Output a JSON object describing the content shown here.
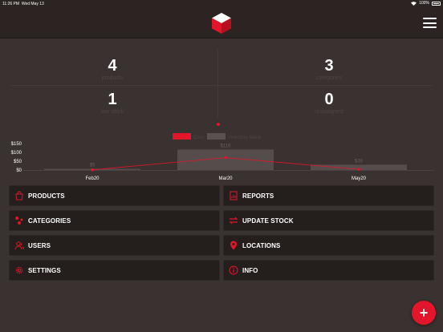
{
  "status_bar": {
    "time": "11:26 PM",
    "date": "Wed May 13",
    "battery": "100%"
  },
  "stats": [
    {
      "value": "4",
      "label": "products"
    },
    {
      "value": "3",
      "label": "categories"
    },
    {
      "value": "1",
      "label": "low stock"
    },
    {
      "value": "0",
      "label": "unassigned"
    }
  ],
  "chart_data": {
    "type": "bar",
    "categories": [
      "Feb20",
      "Mar20",
      "May20"
    ],
    "legend": [
      "Cost",
      "Inventory Value"
    ],
    "series": [
      {
        "name": "Inventory Value",
        "type": "bar",
        "values": [
          5,
          116,
          30
        ],
        "data_labels": [
          "$5",
          "$116",
          "$30"
        ],
        "color": "#5a5250"
      },
      {
        "name": "Cost",
        "type": "line",
        "values": [
          1,
          70,
          4
        ],
        "color": "#e3152a"
      }
    ],
    "y_ticks": [
      "$150",
      "$100",
      "$50",
      "$0"
    ],
    "ylim": [
      0,
      150
    ]
  },
  "menu": [
    {
      "label": "PRODUCTS",
      "icon": "bag-icon"
    },
    {
      "label": "REPORTS",
      "icon": "report-icon"
    },
    {
      "label": "CATEGORIES",
      "icon": "categories-icon"
    },
    {
      "label": "UPDATE STOCK",
      "icon": "arrows-icon"
    },
    {
      "label": "USERS",
      "icon": "users-icon"
    },
    {
      "label": "LOCATIONS",
      "icon": "pin-icon"
    },
    {
      "label": "SETTINGS",
      "icon": "gear-icon"
    },
    {
      "label": "INFO",
      "icon": "info-icon"
    }
  ],
  "fab": {
    "symbol": "+"
  },
  "colors": {
    "accent": "#e3152a",
    "background": "#3a3230",
    "bar": "#2b2422",
    "tile": "#241e1c"
  }
}
